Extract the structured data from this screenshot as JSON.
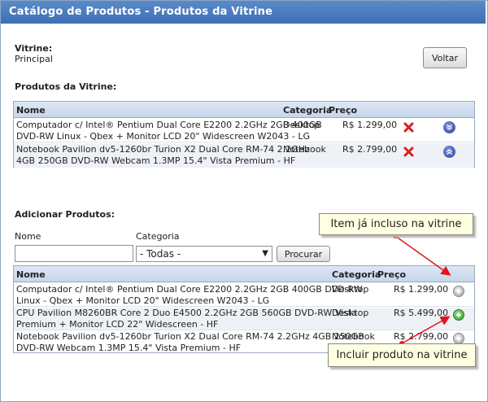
{
  "header": {
    "title": "Catálogo de Produtos - Produtos da Vitrine"
  },
  "vitrine": {
    "label": "Vitrine:",
    "value": "Principal",
    "back_label": "Voltar"
  },
  "vitrine_products": {
    "heading": "Produtos da Vitrine:",
    "columns": {
      "name": "Nome",
      "category": "Categoria",
      "price": "Preço"
    },
    "rows": [
      {
        "name_line1": "Computador c/ Intel® Pentium Dual Core E2200 2.2GHz 2GB 400GB",
        "name_line2": "DVD-RW Linux - Qbex + Monitor LCD 20\" Widescreen W2043 - LG",
        "category": "Desktop",
        "price": "R$ 1.299,00",
        "move_icon": "chevron-down-icon"
      },
      {
        "name_line1": "Notebook Pavilion dv5-1260br Turion X2 Dual Core RM-74 2.2GHz",
        "name_line2": "4GB 250GB DVD-RW Webcam 1.3MP 15.4\" Vista Premium - HF",
        "category": "Notebook",
        "price": "R$ 2.799,00",
        "move_icon": "chevron-up-icon"
      }
    ]
  },
  "add_products": {
    "heading": "Adicionar Produtos:",
    "name_label": "Nome",
    "name_value": "",
    "category_label": "Categoria",
    "category_selected": "- Todas -",
    "search_label": "Procurar",
    "columns": {
      "name": "Nome",
      "category": "Categoria",
      "price": "Preço"
    },
    "rows": [
      {
        "name_line1": "Computador c/ Intel® Pentium Dual Core E2200 2.2GHz 2GB 400GB DVD-RW",
        "name_line2": "Linux - Qbex + Monitor LCD 20\" Widescreen W2043 - LG",
        "category": "Desktop",
        "price": "R$ 1.299,00",
        "status": "included"
      },
      {
        "name_line1": "CPU Pavilion M8260BR Core 2 Duo E4500 2.2GHz 2GB 560GB DVD-RW Vista",
        "name_line2": "Premium + Monitor LCD 22\" Widescreen - HF",
        "category": "Desktop",
        "price": "R$ 5.499,00",
        "status": "add"
      },
      {
        "name_line1": "Notebook Pavilion dv5-1260br Turion X2 Dual Core RM-74 2.2GHz 4GB 250GB",
        "name_line2": "DVD-RW Webcam 1.3MP 15.4\" Vista Premium - HF",
        "category": "Notebook",
        "price": "R$ 2.799,00",
        "status": "add"
      }
    ]
  },
  "callouts": {
    "included": "Item já incluso na vitrine",
    "add": "Incluir produto na vitrine"
  },
  "colors": {
    "title_bar": "#3d6fb3",
    "callout_bg": "#ffffe1",
    "arrow": "#e0141e",
    "delete": "#d81e1e"
  }
}
